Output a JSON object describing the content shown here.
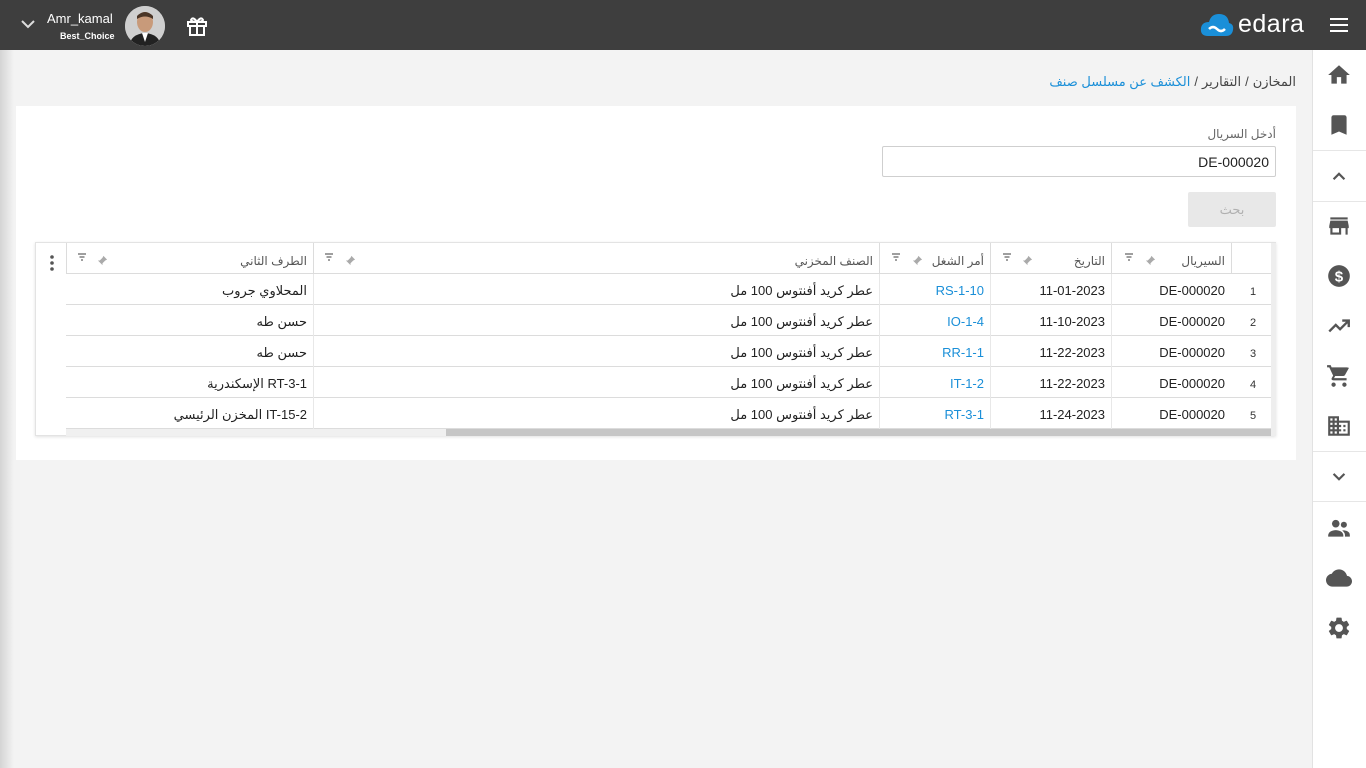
{
  "header": {
    "user_name": "Amr_kamal",
    "company": "Best_Choice",
    "logo_text": "edara",
    "brand_color": "#1a8fd8"
  },
  "breadcrumb": {
    "items": [
      "المخازن",
      "التقارير",
      "الكشف عن مسلسل صنف"
    ],
    "separator": "/"
  },
  "form": {
    "serial_label": "أدخل السريال",
    "serial_value": "DE-000020",
    "search_button": "بحث"
  },
  "grid": {
    "columns": [
      "السيريال",
      "التاريخ",
      "أمر الشغل",
      "الصنف المخزني",
      "الطرف الثاني"
    ],
    "rows": [
      {
        "num": "1",
        "serial": "DE-000020",
        "date": "11-01-2023",
        "order": "RS-1-10",
        "item": "عطر كريد أفنتوس 100 مل",
        "party": "المحلاوي جروب"
      },
      {
        "num": "2",
        "serial": "DE-000020",
        "date": "11-10-2023",
        "order": "IO-1-4",
        "item": "عطر كريد أفنتوس 100 مل",
        "party": "حسن طه"
      },
      {
        "num": "3",
        "serial": "DE-000020",
        "date": "11-22-2023",
        "order": "RR-1-1",
        "item": "عطر كريد أفنتوس 100 مل",
        "party": "حسن طه"
      },
      {
        "num": "4",
        "serial": "DE-000020",
        "date": "11-22-2023",
        "order": "IT-1-2",
        "item": "عطر كريد أفنتوس 100 مل",
        "party": "الإسكندرية RT-3-1"
      },
      {
        "num": "5",
        "serial": "DE-000020",
        "date": "11-24-2023",
        "order": "RT-3-1",
        "item": "عطر كريد أفنتوس 100 مل",
        "party": "المخزن الرئيسي IT-15-2"
      }
    ]
  },
  "sidebar": {
    "icons": [
      "home-icon",
      "bookmark-icon",
      "chevron-up-icon",
      "store-icon",
      "dollar-icon",
      "trending-up-icon",
      "cart-icon",
      "building-icon",
      "chevron-down-icon",
      "people-icon",
      "cloud-icon",
      "settings-icon"
    ]
  }
}
